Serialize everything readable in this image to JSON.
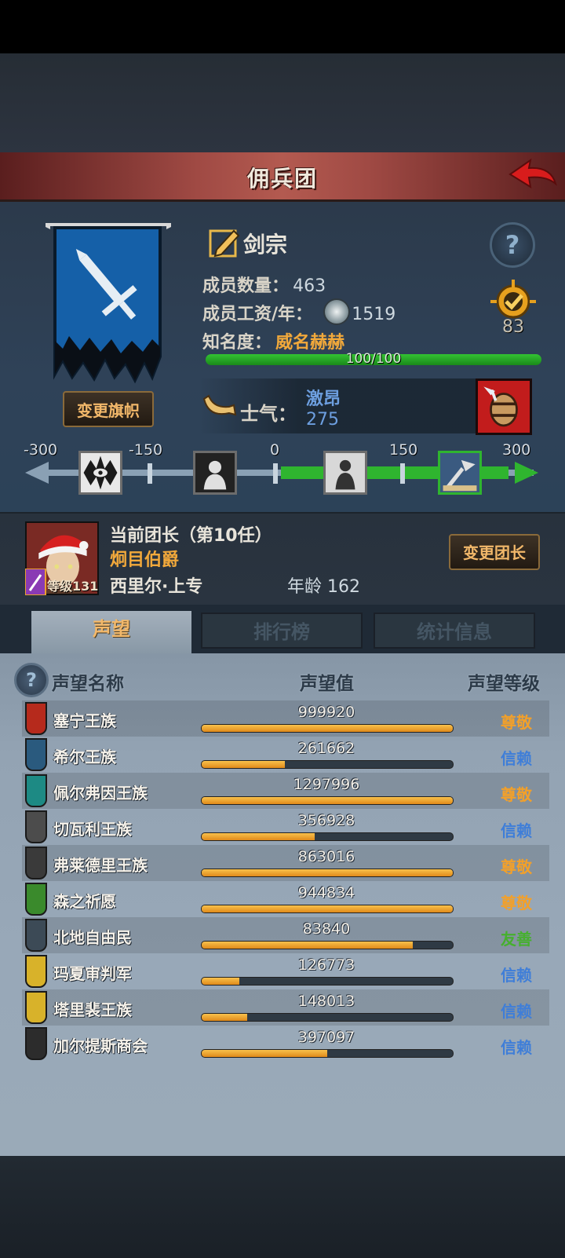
{
  "header": {
    "title": "佣兵团"
  },
  "guild": {
    "name": "剑宗",
    "members_label": "成员数量：",
    "members_value": "463",
    "wage_label": "成员工资/年：",
    "wage_value": "1519",
    "fame_label": "知名度：",
    "fame_value": "威名赫赫",
    "fame_progress": "100/100",
    "fame_fraction": 1.0,
    "badge_value": "83",
    "change_flag_label": "变更旗帜"
  },
  "morale": {
    "label": "士气：",
    "state": "激昂",
    "value": "275",
    "scale_ticks": [
      "-300",
      "-150",
      "0",
      "150",
      "300"
    ]
  },
  "leader": {
    "title": "当前团长（第10任）",
    "name": "炯目伯爵",
    "level": "等级131",
    "info": "西里尔·上专",
    "age": "年龄 162",
    "change_label": "变更团长"
  },
  "tabs": [
    {
      "label": "声望"
    },
    {
      "label": "排行榜"
    },
    {
      "label": "统计信息"
    }
  ],
  "reputation": {
    "col_name": "声望名称",
    "col_value": "声望值",
    "col_level": "声望等级",
    "rows": [
      {
        "name": "塞宁王族",
        "value": "999920",
        "fill": 1.0,
        "level": "尊敬",
        "level_color": "#f2a02a",
        "crest_color": "#b62a1c"
      },
      {
        "name": "希尔王族",
        "value": "261662",
        "fill": 0.33,
        "level": "信赖",
        "level_color": "#3f7ed8",
        "crest_color": "#2a5a7e"
      },
      {
        "name": "佩尔弗因王族",
        "value": "1297996",
        "fill": 1.0,
        "level": "尊敬",
        "level_color": "#f2a02a",
        "crest_color": "#1d8a84"
      },
      {
        "name": "切瓦利王族",
        "value": "356928",
        "fill": 0.45,
        "level": "信赖",
        "level_color": "#3f7ed8",
        "crest_color": "#4c4c4c"
      },
      {
        "name": "弗莱德里王族",
        "value": "863016",
        "fill": 1.0,
        "level": "尊敬",
        "level_color": "#f2a02a",
        "crest_color": "#3a3a3a"
      },
      {
        "name": "森之祈愿",
        "value": "944834",
        "fill": 1.0,
        "level": "尊敬",
        "level_color": "#f2a02a",
        "crest_color": "#3a8a2c"
      },
      {
        "name": "北地自由民",
        "value": "83840",
        "fill": 0.84,
        "level": "友善",
        "level_color": "#46b02e",
        "crest_color": "#3c4a56"
      },
      {
        "name": "玛夏审判军",
        "value": "126773",
        "fill": 0.15,
        "level": "信赖",
        "level_color": "#3f7ed8",
        "crest_color": "#d8b22a"
      },
      {
        "name": "塔里裴王族",
        "value": "148013",
        "fill": 0.18,
        "level": "信赖",
        "level_color": "#3f7ed8",
        "crest_color": "#d8b22a"
      },
      {
        "name": "加尔提斯商会",
        "value": "397097",
        "fill": 0.5,
        "level": "信赖",
        "level_color": "#3f7ed8",
        "crest_color": "#2c2c2c"
      }
    ]
  }
}
